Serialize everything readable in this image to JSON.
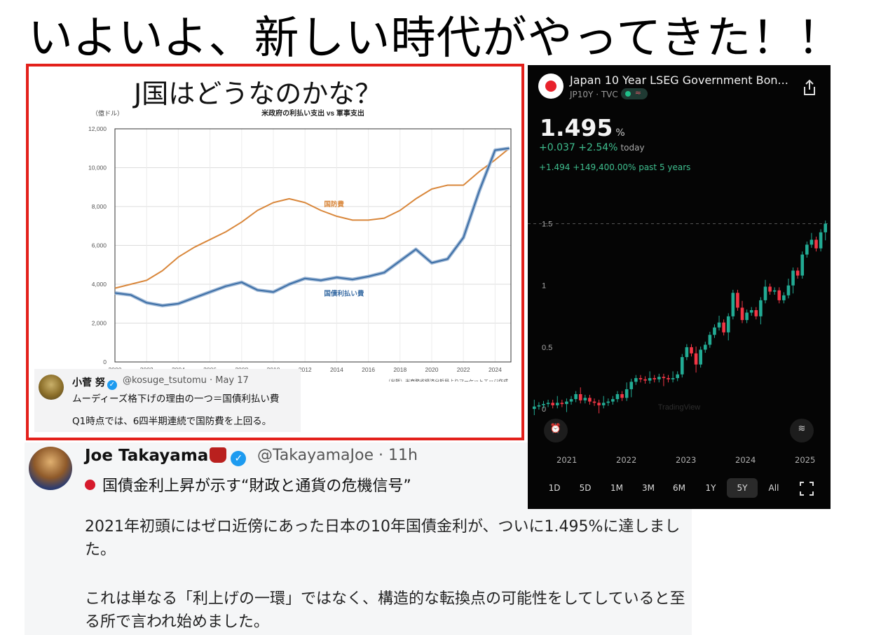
{
  "headline": "いよいよ、新しい時代がやってきた！！",
  "left_panel": {
    "heading": "J国はどうなのかな？",
    "chart_data": {
      "type": "line",
      "title": "米政府の利払い支出 vs 軍事支出",
      "ylabel": "（億ドル）",
      "xlabel": "",
      "xlim": [
        2000,
        2025
      ],
      "ylim": [
        0,
        12000
      ],
      "grid": true,
      "x_ticks": [
        "2000",
        "2002",
        "2004",
        "2006",
        "2008",
        "2010",
        "2012",
        "2014",
        "2016",
        "2018",
        "2020",
        "2022",
        "2024"
      ],
      "y_ticks": [
        "0",
        "2,000",
        "4,000",
        "6,000",
        "8,000",
        "10,000",
        "12,000"
      ],
      "series": [
        {
          "name": "国防費",
          "color": "#d9873b",
          "x": [
            2000,
            2001,
            2002,
            2003,
            2004,
            2005,
            2006,
            2007,
            2008,
            2009,
            2010,
            2011,
            2012,
            2013,
            2014,
            2015,
            2016,
            2017,
            2018,
            2019,
            2020,
            2021,
            2022,
            2023,
            2024,
            2024.9
          ],
          "y": [
            3800,
            4000,
            4200,
            4700,
            5400,
            5900,
            6300,
            6700,
            7200,
            7800,
            8200,
            8400,
            8200,
            7800,
            7500,
            7300,
            7300,
            7400,
            7800,
            8400,
            8900,
            9100,
            9100,
            9800,
            10400,
            11000
          ]
        },
        {
          "name": "国債利払い費",
          "color": "#3d6fa6",
          "x": [
            2000,
            2001,
            2002,
            2003,
            2004,
            2005,
            2006,
            2007,
            2008,
            2009,
            2010,
            2011,
            2012,
            2013,
            2014,
            2015,
            2016,
            2017,
            2018,
            2019,
            2020,
            2021,
            2022,
            2023,
            2024,
            2024.9
          ],
          "y": [
            3550,
            3450,
            3050,
            2900,
            3000,
            3300,
            3600,
            3900,
            4100,
            3700,
            3600,
            4000,
            4300,
            4200,
            4350,
            4250,
            4400,
            4600,
            5200,
            5800,
            5100,
            5300,
            6400,
            8800,
            10900,
            11000
          ]
        }
      ],
      "source": "（出所）米商務省経済分析局よりマーケットエッジ作成"
    },
    "tweet": {
      "name": "小菅 努",
      "handle": "@kosuge_tsutomu · May 17",
      "line1": "ムーディーズ格下げの理由の一つ＝国債利払い費",
      "line2": "Q1時点では、6四半期連続で国防費を上回る。"
    }
  },
  "tweet_main": {
    "name": "Joe Takayama",
    "handle": "@TakayamaJoe · 11h",
    "title": "国債金利上昇が示す“財政と通貨の危機信号”",
    "para1": "2021年初頭にはゼロ近傍にあった日本の10年国債金利が、ついに1.495%に達しました。",
    "para2": "これは単なる「利上げの一環」ではなく、構造的な転換点の可能性をしてしていると至る所で言われ始めました。"
  },
  "phone": {
    "title": "Japan 10 Year LSEG Government Bon...",
    "subtitle": "JP10Y · TVC",
    "badge_symbol": "≈",
    "price": "1.495",
    "price_unit": "%",
    "change_today": "+0.037 +2.54%",
    "change_today_label": "today",
    "change_5y": "+1.494 +149,400.00% past 5 years",
    "watermark": "TradingView",
    "chart_data": {
      "type": "candlestick",
      "y_ticks": [
        "1.5",
        "1",
        "0.5",
        "0"
      ],
      "ylim": [
        -0.05,
        1.65
      ],
      "x_labels": [
        "2021",
        "2022",
        "2023",
        "2024",
        "2025"
      ],
      "reference_line": 1.5,
      "up_color": "#22ab94",
      "down_color": "#f23645",
      "closes": [
        0.02,
        0.03,
        0.04,
        0.05,
        0.03,
        0.05,
        0.04,
        0.06,
        0.08,
        0.12,
        0.07,
        0.09,
        0.06,
        0.05,
        0.03,
        0.05,
        0.06,
        0.08,
        0.12,
        0.09,
        0.16,
        0.22,
        0.25,
        0.24,
        0.23,
        0.25,
        0.24,
        0.26,
        0.25,
        0.24,
        0.25,
        0.28,
        0.42,
        0.5,
        0.45,
        0.36,
        0.48,
        0.52,
        0.6,
        0.66,
        0.7,
        0.62,
        0.75,
        0.94,
        0.82,
        0.72,
        0.78,
        0.8,
        0.75,
        0.88,
        0.99,
        0.95,
        0.96,
        0.88,
        0.92,
        1.0,
        1.12,
        1.08,
        1.25,
        1.33,
        1.37,
        1.3,
        1.43,
        1.5
      ]
    },
    "years": [
      "2021",
      "2022",
      "2023",
      "2024",
      "2025"
    ],
    "ranges": [
      "1D",
      "5D",
      "1M",
      "3M",
      "6M",
      "1Y",
      "5Y",
      "All"
    ],
    "active_range": "5Y"
  }
}
